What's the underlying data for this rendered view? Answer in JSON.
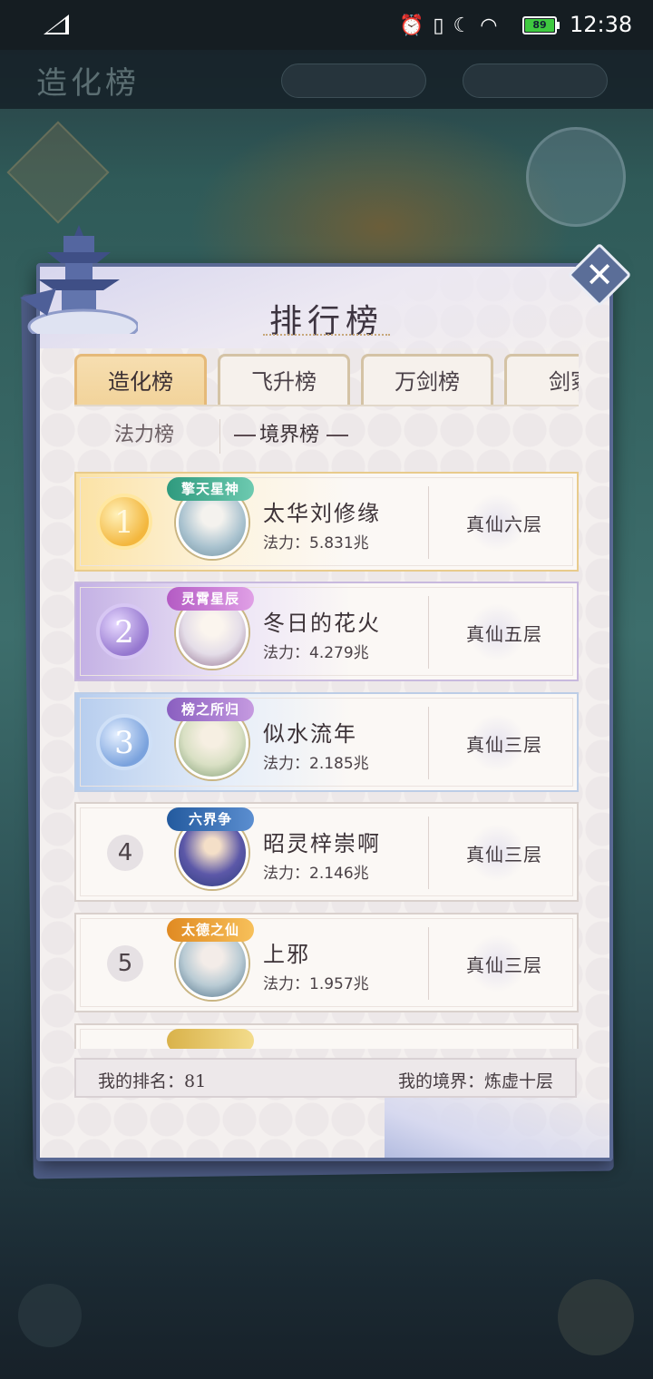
{
  "status_bar": {
    "time": "12:38",
    "battery": "89",
    "icons": [
      "signal-icon",
      "alarm-icon",
      "vibrate-icon",
      "moon-icon",
      "wifi-icon",
      "battery-icon"
    ]
  },
  "modal": {
    "title": "排行榜",
    "tabs": [
      {
        "label": "造化榜",
        "active": true
      },
      {
        "label": "飞升榜",
        "active": false
      },
      {
        "label": "万剑榜",
        "active": false
      },
      {
        "label": "剑冢",
        "active": false
      }
    ],
    "subtabs": [
      {
        "label": "法力榜",
        "active": false
      },
      {
        "label": "境界榜",
        "active": true
      }
    ],
    "power_label": "法力：",
    "rows": [
      {
        "rank": "1",
        "name": "太华刘修缘",
        "power": "5.831兆",
        "realm": "真仙六层",
        "title_badge": "擎天星神"
      },
      {
        "rank": "2",
        "name": "冬日的花火",
        "power": "4.279兆",
        "realm": "真仙五层",
        "title_badge": "灵霄星辰"
      },
      {
        "rank": "3",
        "name": "似水流年",
        "power": "2.185兆",
        "realm": "真仙三层",
        "title_badge": "榜之所归"
      },
      {
        "rank": "4",
        "name": "昭灵梓崇啊",
        "power": "2.146兆",
        "realm": "真仙三层",
        "title_badge": "六界争"
      },
      {
        "rank": "5",
        "name": "上邪",
        "power": "1.957兆",
        "realm": "真仙三层",
        "title_badge": "太德之仙"
      }
    ],
    "footer": {
      "my_rank": "我的排名：81",
      "my_realm": "我的境界：炼虚十层"
    }
  },
  "background": {
    "title": "造化榜"
  },
  "colors": {
    "frame": "#5a6994",
    "active_tab": "#f2d39a",
    "gold": "#f3b73e",
    "purple": "#9577cf",
    "blue": "#7aa2dd"
  }
}
